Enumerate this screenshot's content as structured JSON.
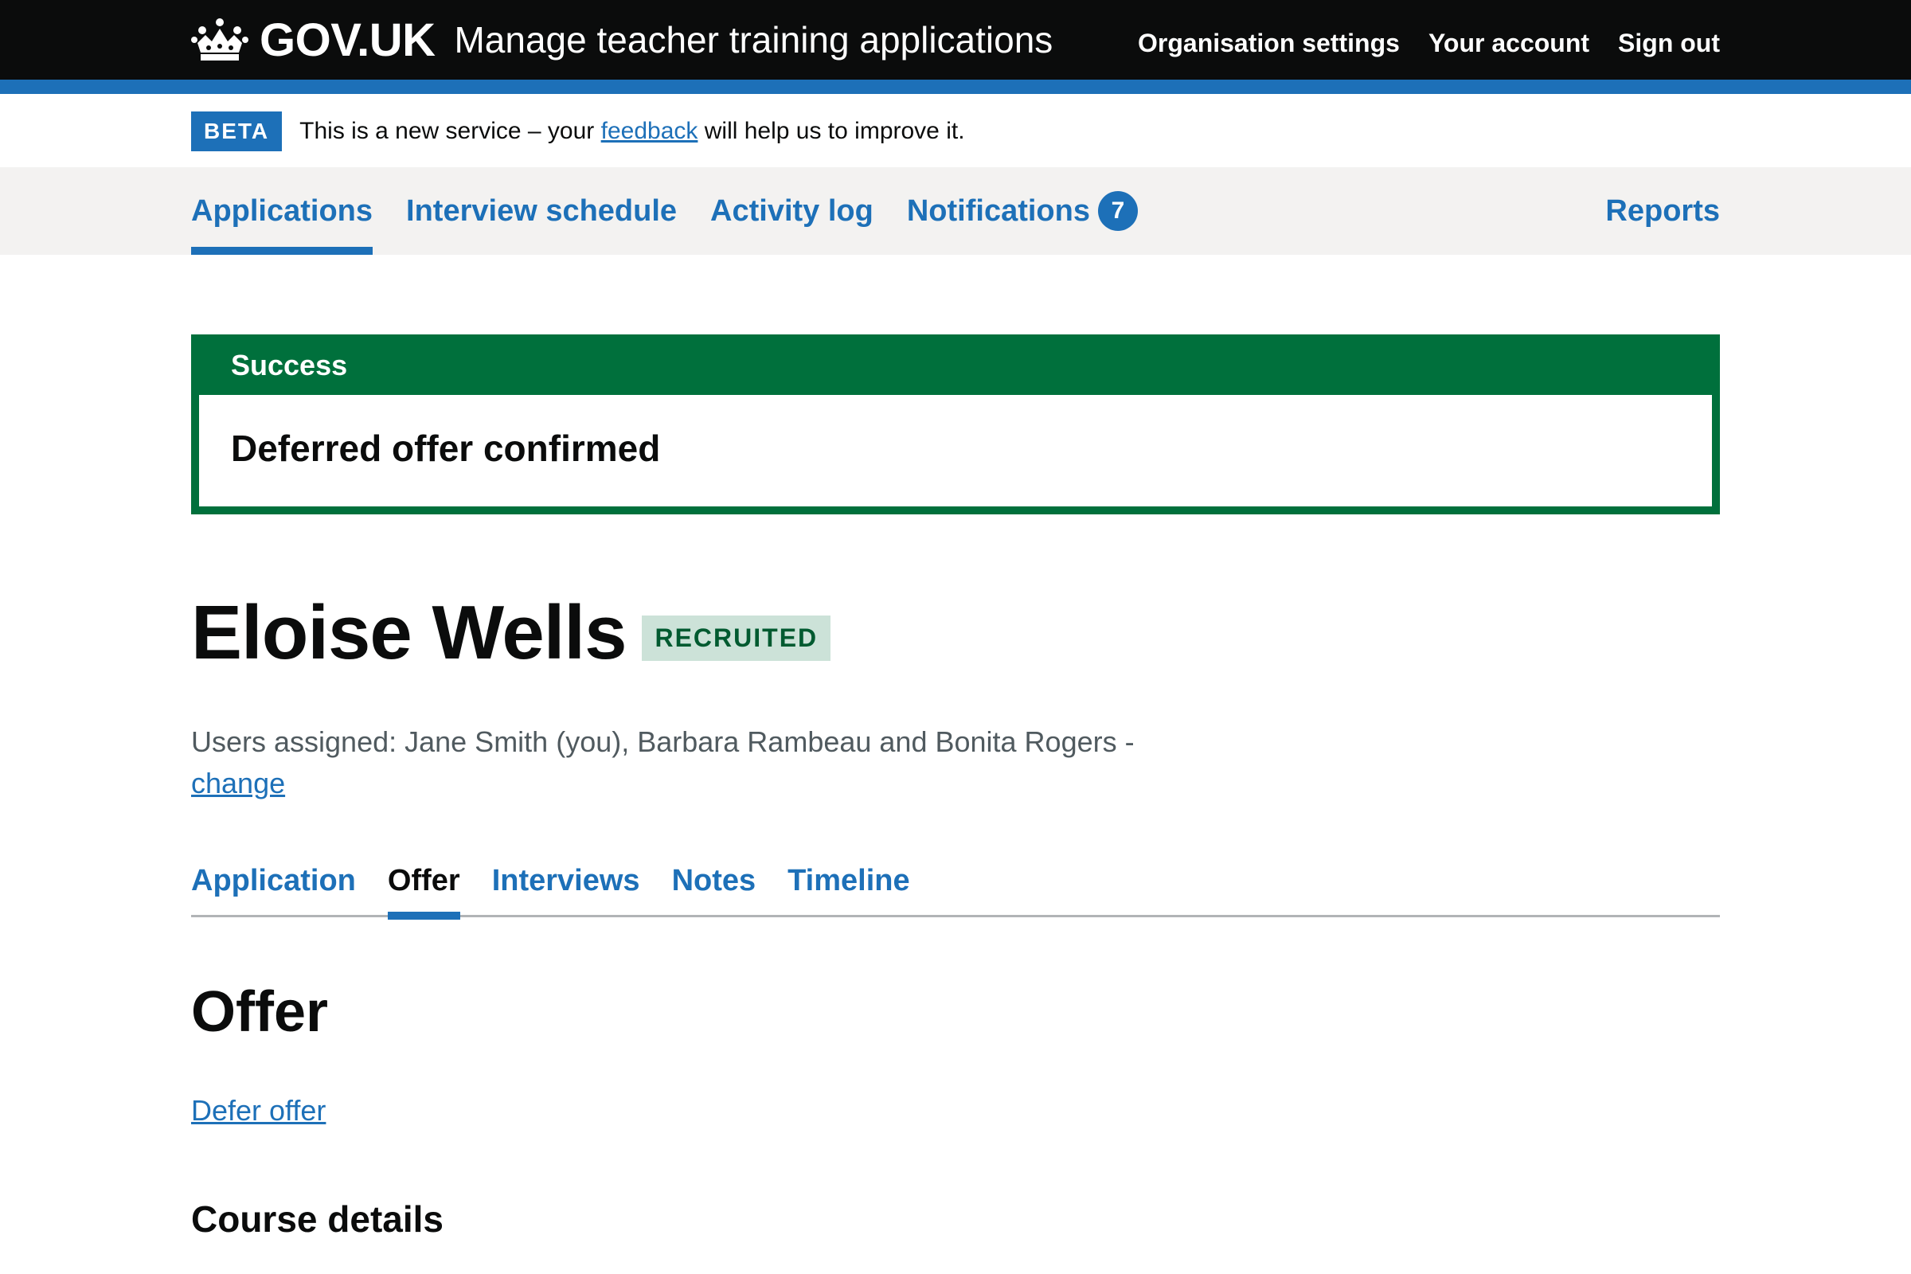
{
  "header": {
    "logo_text": "GOV.UK",
    "service_name": "Manage teacher training applications",
    "nav": [
      "Organisation settings",
      "Your account",
      "Sign out"
    ]
  },
  "beta": {
    "tag": "BETA",
    "text_before": "This is a new service – your ",
    "link_text": "feedback",
    "text_after": " will help us to improve it."
  },
  "primary_nav": {
    "items": [
      "Applications",
      "Interview schedule",
      "Activity log",
      "Notifications"
    ],
    "active": "Applications",
    "notifications_count": "7",
    "right_item": "Reports"
  },
  "success": {
    "title": "Success",
    "heading": "Deferred offer confirmed"
  },
  "candidate": {
    "name": "Eloise Wells",
    "status": "RECRUITED",
    "assigned_text": "Users assigned: Jane Smith (you), Barbara Rambeau and Bonita Rogers - ",
    "change_link": "change"
  },
  "sub_nav": {
    "items": [
      "Application",
      "Offer",
      "Interviews",
      "Notes",
      "Timeline"
    ],
    "current": "Offer"
  },
  "main": {
    "heading": "Offer",
    "defer_link": "Defer offer",
    "section_heading": "Course details"
  },
  "colors": {
    "brand_blue": "#1d70b8",
    "header_black": "#0b0c0c",
    "success_green": "#00703c",
    "tag_green_bg": "#cce2d8",
    "tag_green_text": "#005a30"
  }
}
